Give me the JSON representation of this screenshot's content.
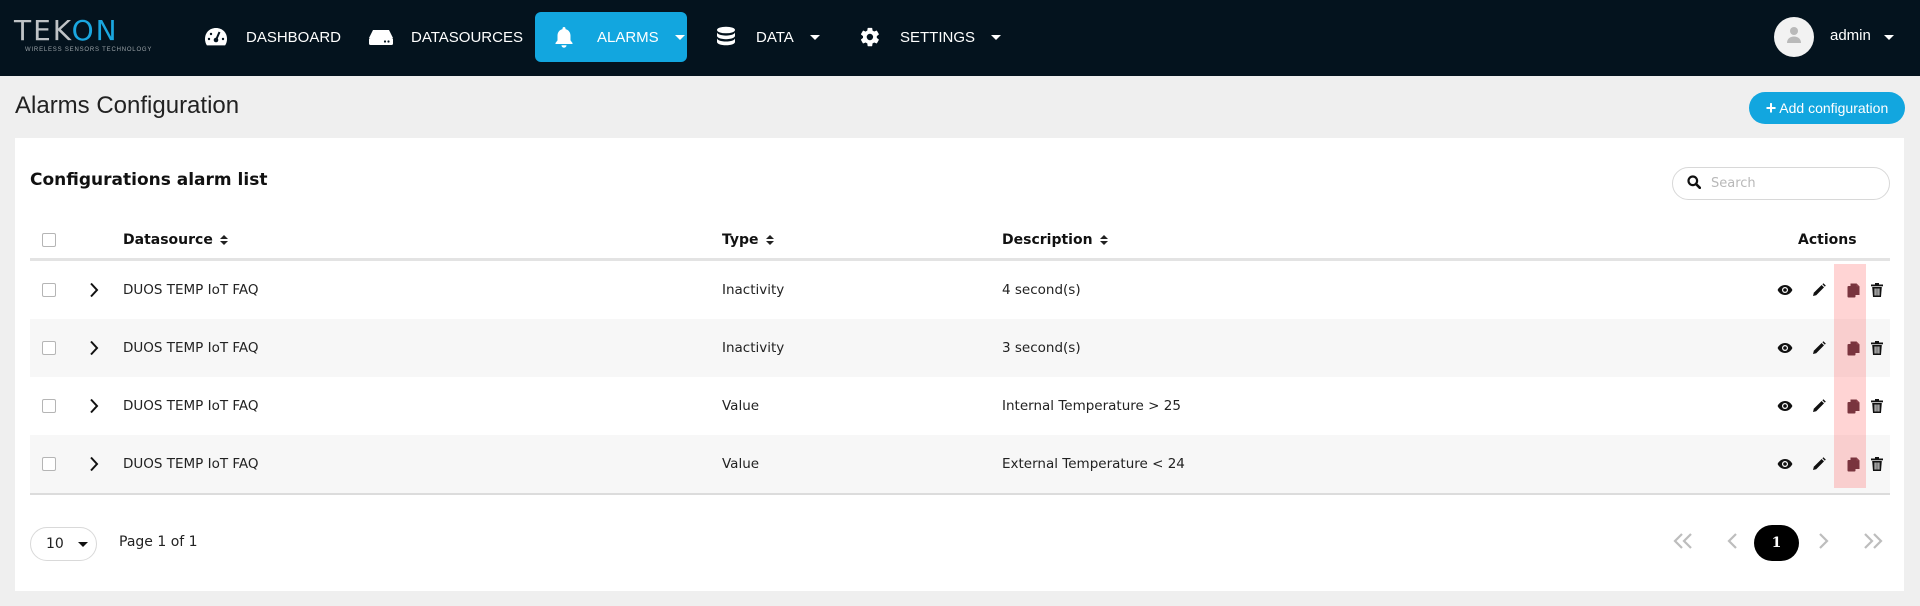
{
  "brand": {
    "name_prefix": "TEK",
    "name_suffix": "ON",
    "tagline": "WIRELESS SENSORS TECHNOLOGY",
    "accent_color": "#12a6df",
    "navbar_color": "#04131e"
  },
  "nav": {
    "items": [
      {
        "label": "DASHBOARD",
        "icon": "gauge-icon",
        "active": false,
        "has_dropdown": false
      },
      {
        "label": "DATASOURCES",
        "icon": "server-icon",
        "active": false,
        "has_dropdown": false
      },
      {
        "label": "ALARMS",
        "icon": "bell-icon",
        "active": true,
        "has_dropdown": true
      },
      {
        "label": "DATA",
        "icon": "database-icon",
        "active": false,
        "has_dropdown": true
      },
      {
        "label": "SETTINGS",
        "icon": "gear-icon",
        "active": false,
        "has_dropdown": true
      }
    ],
    "user": {
      "name": "admin",
      "icon": "user-icon"
    }
  },
  "page": {
    "title": "Alarms Configuration",
    "add_button_label": "Add configuration"
  },
  "card": {
    "title": "Configurations alarm list",
    "search_placeholder": "Search",
    "search_value": ""
  },
  "table": {
    "columns": {
      "datasource": "Datasource",
      "type": "Type",
      "description": "Description",
      "actions": "Actions"
    },
    "rows": [
      {
        "datasource": "DUOS TEMP IoT FAQ",
        "type": "Inactivity",
        "description": "4 second(s)"
      },
      {
        "datasource": "DUOS TEMP IoT FAQ",
        "type": "Inactivity",
        "description": "3 second(s)"
      },
      {
        "datasource": "DUOS TEMP IoT FAQ",
        "type": "Value",
        "description": "Internal Temperature > 25"
      },
      {
        "datasource": "DUOS TEMP IoT FAQ",
        "type": "Value",
        "description": "External Temperature < 24"
      }
    ],
    "row_actions": [
      "view",
      "edit",
      "copy",
      "delete"
    ],
    "highlighted_action": "copy"
  },
  "pagination": {
    "page_size": "10",
    "page_info": "Page 1 of 1",
    "current_page": "1",
    "first_glyph": "«",
    "prev_glyph": "‹",
    "next_glyph": "›",
    "last_glyph": "»"
  }
}
